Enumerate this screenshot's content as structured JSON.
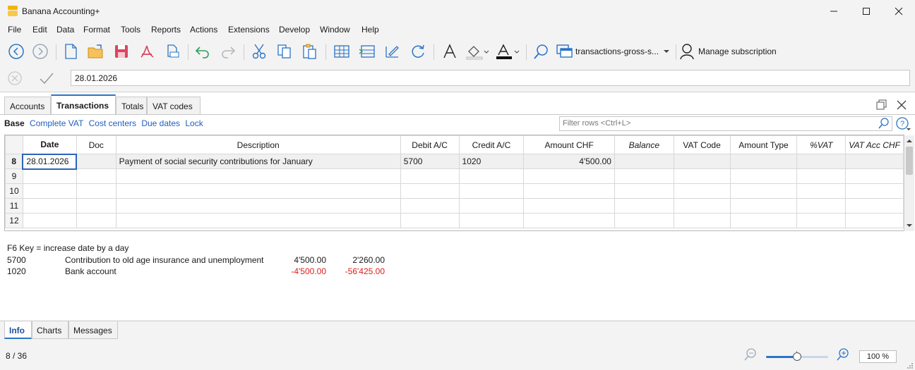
{
  "window": {
    "title": "Banana Accounting+"
  },
  "menu": [
    "File",
    "Edit",
    "Data",
    "Format",
    "Tools",
    "Reports",
    "Actions",
    "Extensions",
    "Develop",
    "Window",
    "Help"
  ],
  "toolbar": {
    "document_name": "transactions-gross-s...",
    "manage_subscription": "Manage subscription"
  },
  "edit_line": {
    "value": "28.01.2026"
  },
  "tabs": [
    "Accounts",
    "Transactions",
    "Totals",
    "VAT codes"
  ],
  "active_tab": "Transactions",
  "views": {
    "active": "Base",
    "links": [
      "Complete VAT",
      "Cost centers",
      "Due dates",
      "Lock"
    ]
  },
  "filter": {
    "placeholder": "Filter rows <Ctrl+L>"
  },
  "table": {
    "columns": [
      "Date",
      "Doc",
      "Description",
      "Debit A/C",
      "Credit A/C",
      "Amount CHF",
      "Balance",
      "VAT Code",
      "Amount Type",
      "%VAT",
      "VAT Acc CHF"
    ],
    "rows": [
      {
        "num": "8",
        "date": "28.01.2026",
        "doc": "",
        "description": "Payment of social security contributions for January",
        "debit": "5700",
        "credit": "1020",
        "amount": "4'500.00",
        "balance": "",
        "vat_code": "",
        "amount_type": "",
        "vat_pct": "",
        "vat_acc": ""
      },
      {
        "num": "9",
        "date": "",
        "doc": "",
        "description": "",
        "debit": "",
        "credit": "",
        "amount": "",
        "balance": "",
        "vat_code": "",
        "amount_type": "",
        "vat_pct": "",
        "vat_acc": ""
      },
      {
        "num": "10",
        "date": "",
        "doc": "",
        "description": "",
        "debit": "",
        "credit": "",
        "amount": "",
        "balance": "",
        "vat_code": "",
        "amount_type": "",
        "vat_pct": "",
        "vat_acc": ""
      },
      {
        "num": "11",
        "date": "",
        "doc": "",
        "description": "",
        "debit": "",
        "credit": "",
        "amount": "",
        "balance": "",
        "vat_code": "",
        "amount_type": "",
        "vat_pct": "",
        "vat_acc": ""
      },
      {
        "num": "12",
        "date": "",
        "doc": "",
        "description": "",
        "debit": "",
        "credit": "",
        "amount": "",
        "balance": "",
        "vat_code": "",
        "amount_type": "",
        "vat_pct": "",
        "vat_acc": ""
      }
    ]
  },
  "info": {
    "hint": "F6 Key = increase date by a day",
    "lines": [
      {
        "account": "5700",
        "description": "Contribution to old age insurance and unemployment",
        "amount": "4'500.00",
        "balance": "2'260.00",
        "negative": false
      },
      {
        "account": "1020",
        "description": "Bank account",
        "amount": "-4'500.00",
        "balance": "-56'425.00",
        "negative": true
      }
    ]
  },
  "bottom_tabs": [
    "Info",
    "Charts",
    "Messages"
  ],
  "active_bottom_tab": "Info",
  "status": {
    "position": "8 / 36",
    "zoom": "100 %",
    "zoom_level": 0.5
  },
  "colors": {
    "accent": "#2a74c7",
    "negative": "#e01b1b",
    "logo": "#f4b400"
  }
}
